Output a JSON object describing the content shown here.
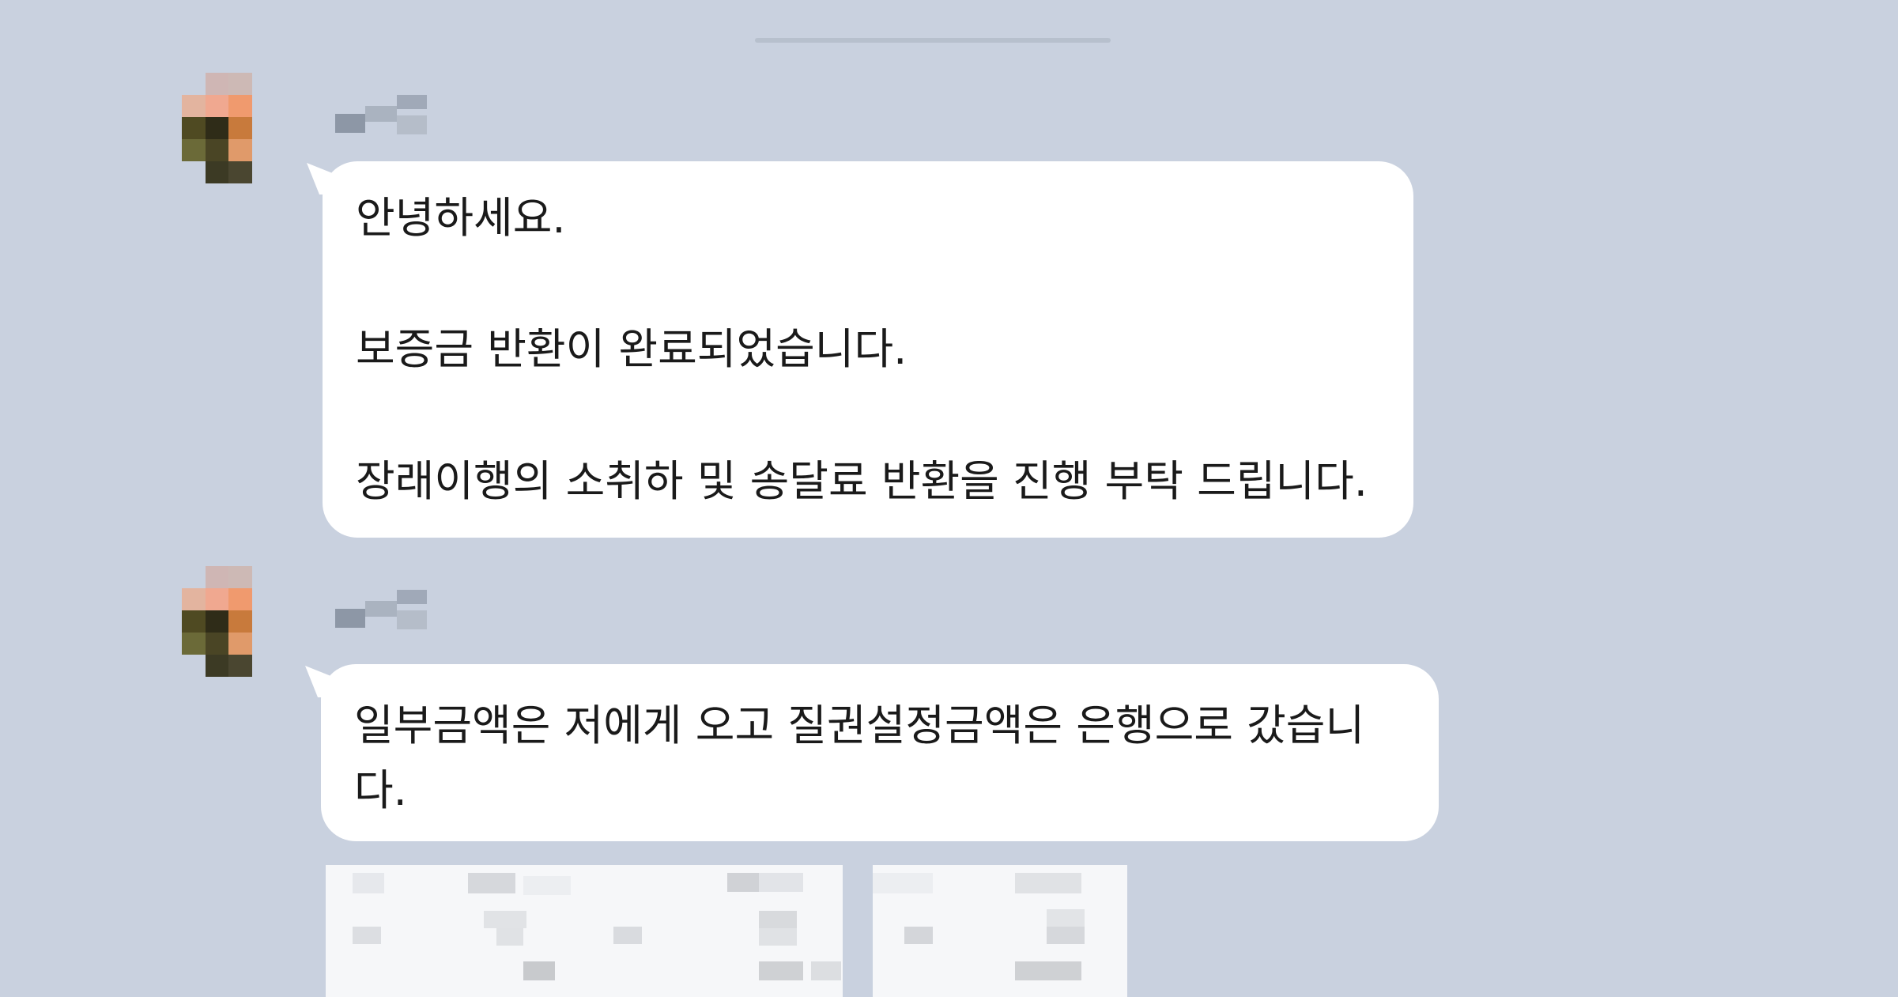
{
  "chat": {
    "messages": [
      {
        "lines": [
          "안녕하세요.",
          "보증금 반환이 완료되었습니다.",
          "장래이행의 소취하 및 송달료 반환을 진행 부탁 드립니다."
        ]
      },
      {
        "lines": [
          "일부금액은 저에게 오고 질권설정금액은 은행으로 갔습니",
          "다."
        ]
      }
    ]
  },
  "icons": {
    "avatar": "avatar-icon",
    "image": "image-thumbnail-icon"
  },
  "colors": {
    "background": "#c9d1df",
    "bubble": "#ffffff",
    "text": "#1a1a1a"
  }
}
